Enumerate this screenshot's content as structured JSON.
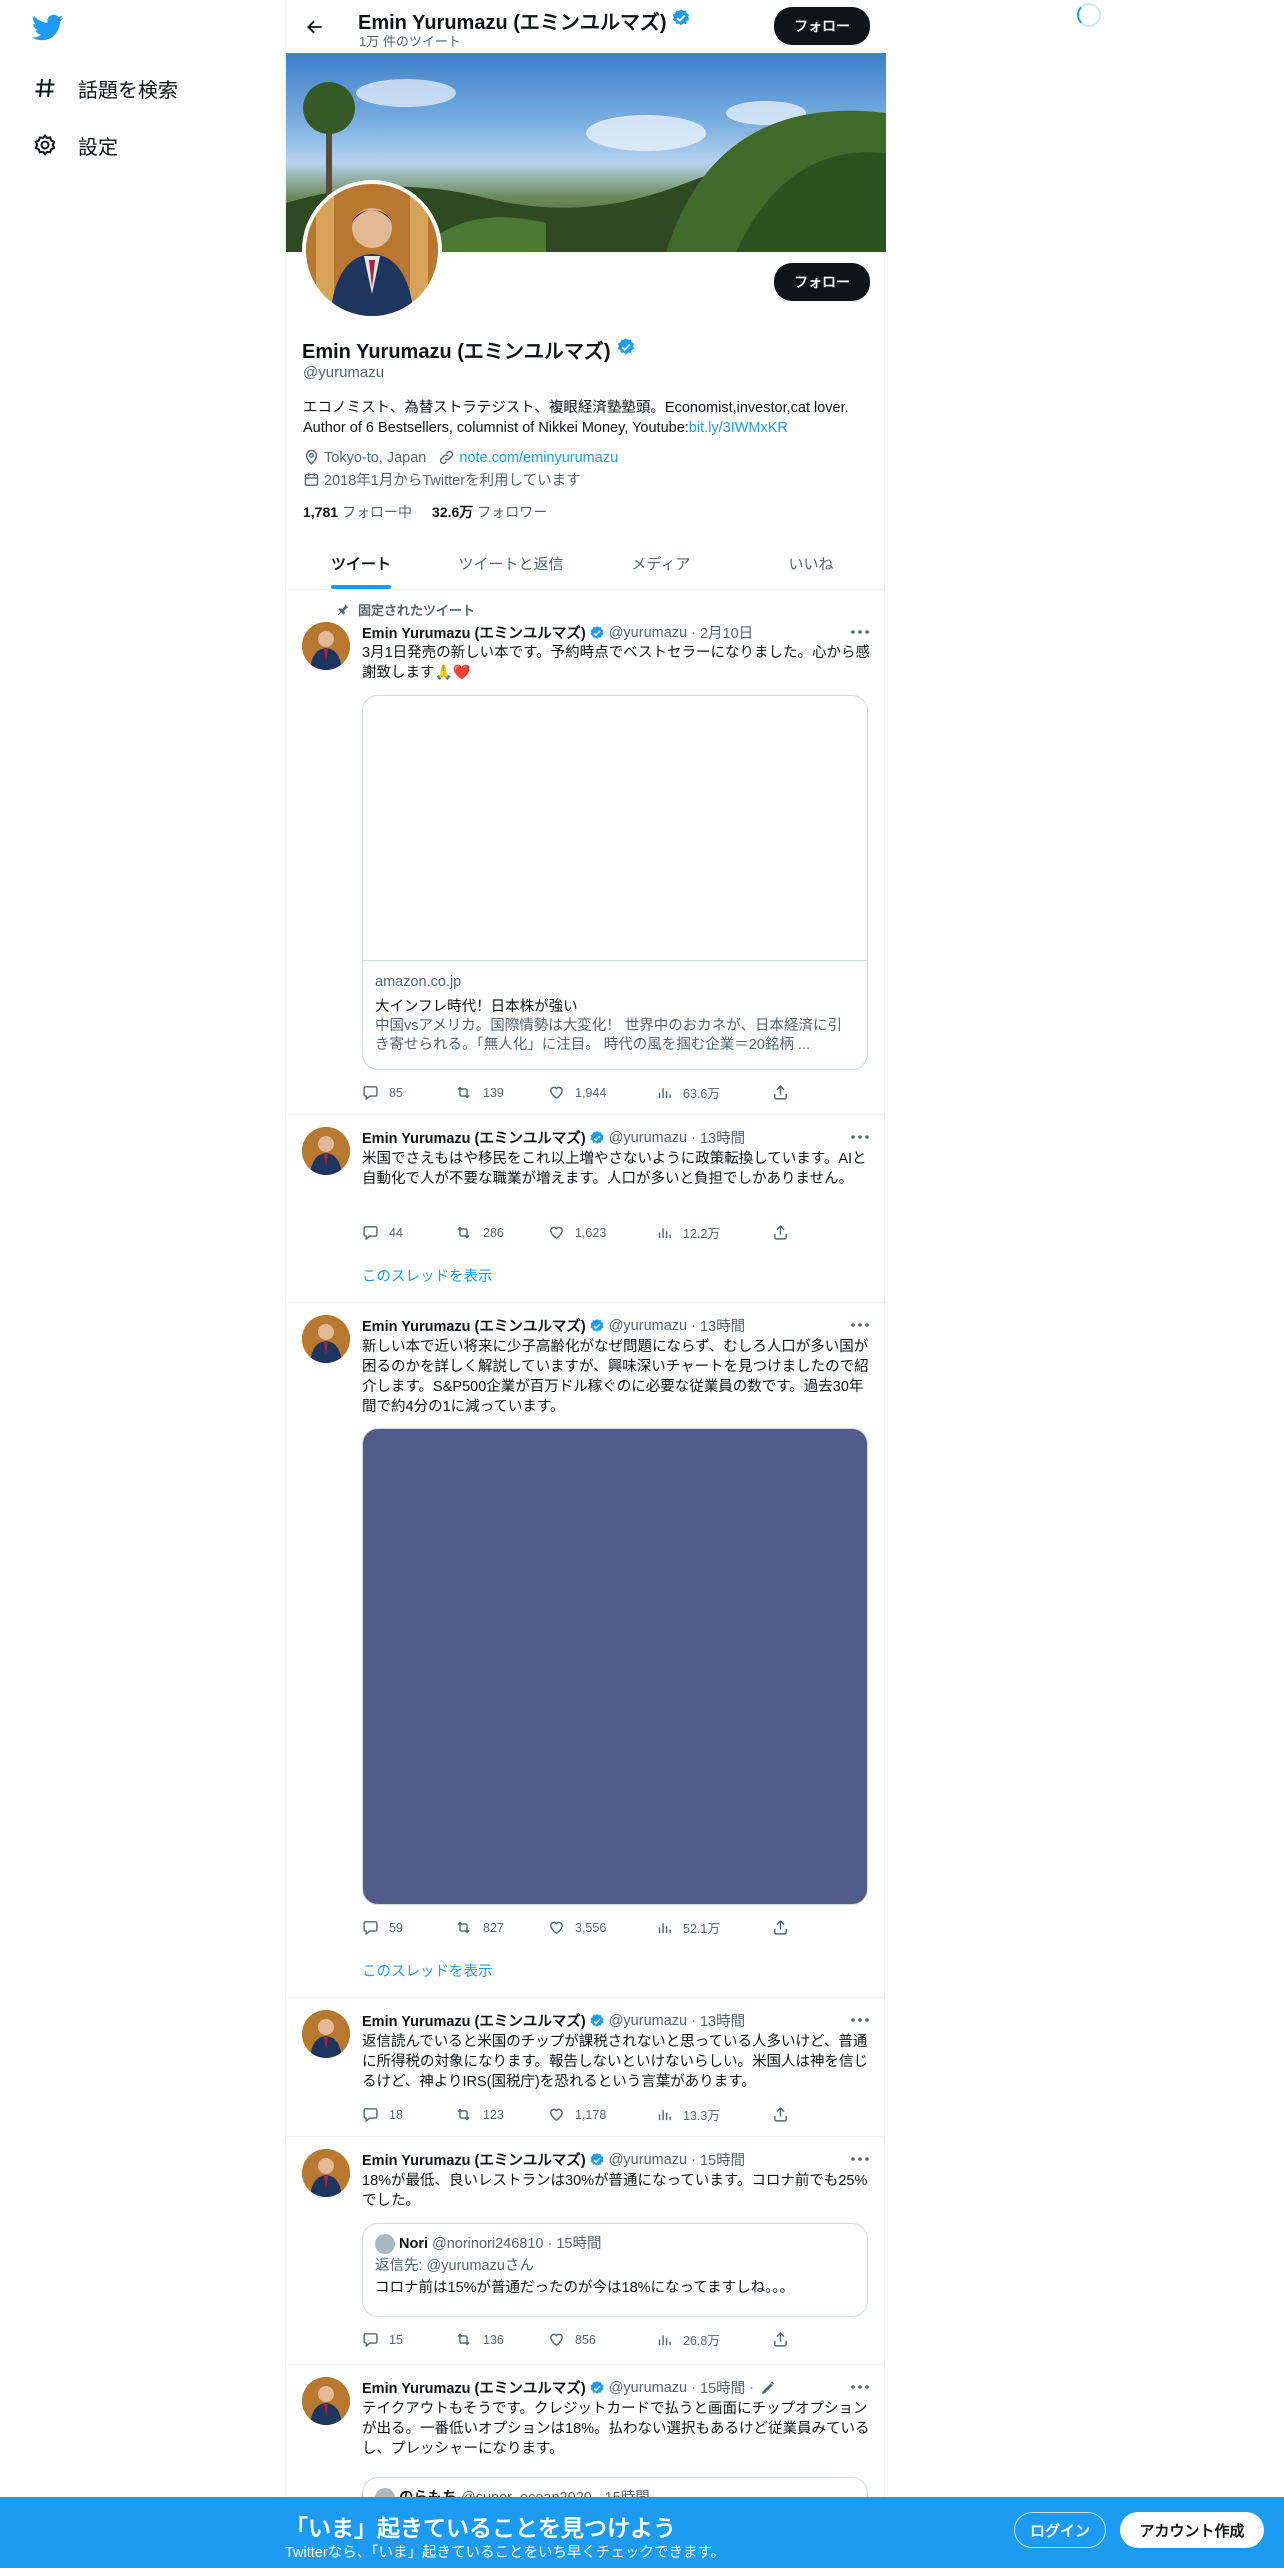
{
  "nav": {
    "explore_label": "話題を検索",
    "settings_label": "設定"
  },
  "header": {
    "name": "Emin Yurumazu (エミンユルマズ)",
    "tweet_count": "1万 件のツイート",
    "follow_label": "フォロー"
  },
  "profile": {
    "name": "Emin Yurumazu (エミンユルマズ)",
    "handle": "@yurumazu",
    "bio_text": "エコノミスト、為替ストラテジスト、複眼経済塾塾頭。Economist,investor,cat lover. Author of 6 Bestsellers, columnist of Nikkei Money, Youtube:",
    "bio_link": "bit.ly/3IWMxKR",
    "location": "Tokyo-to, Japan",
    "website": "note.com/eminyurumazu",
    "joined": "2018年1月からTwitterを利用しています",
    "following_count": "1,781",
    "following_label": "フォロー中",
    "followers_count": "32.6万",
    "followers_label": "フォロワー",
    "follow_label": "フォロー"
  },
  "tabs": [
    "ツイート",
    "ツイートと返信",
    "メディア",
    "いいね"
  ],
  "tweets": [
    {
      "pinned_label": "固定されたツイート",
      "name": "Emin Yurumazu (エミンユルマズ)",
      "handle": "@yurumazu",
      "time": "2月10日",
      "text": "3月1日発売の新しい本です。予約時点でベストセラーになりました。心から感謝致します🙏❤️",
      "card": {
        "domain": "amazon.co.jp",
        "title": "大インフレ時代！日本株が強い",
        "description": "中国vsアメリカ。国際情勢は大変化！ 世界中のおカネが、日本経済に引き寄せられる。「無人化」に注目。 時代の風を掴む企業＝20銘柄 ..."
      },
      "replies": "85",
      "retweets": "139",
      "likes": "1,944",
      "views": "63.6万"
    },
    {
      "name": "Emin Yurumazu (エミンユルマズ)",
      "handle": "@yurumazu",
      "time": "13時間",
      "text": "米国でさえもはや移民をこれ以上増やさないように政策転換しています。AIと自動化で人が不要な職業が増えます。人口が多いと負担でしかありません。",
      "replies": "44",
      "retweets": "286",
      "likes": "1,623",
      "views": "12.2万",
      "thread_label": "このスレッドを表示"
    },
    {
      "name": "Emin Yurumazu (エミンユルマズ)",
      "handle": "@yurumazu",
      "time": "13時間",
      "text": "新しい本で近い将来に少子高齢化がなぜ問題にならず、むしろ人口が多い国が困るのかを詳しく解説していますが、興味深いチャートを見つけましたので紹介します。S&P500企業が百万ドル稼ぐのに必要な従業員の数です。過去30年間で約4分の1に減っています。",
      "replies": "59",
      "retweets": "827",
      "likes": "3,556",
      "views": "52.1万",
      "thread_label": "このスレッドを表示"
    },
    {
      "name": "Emin Yurumazu (エミンユルマズ)",
      "handle": "@yurumazu",
      "time": "13時間",
      "text": "返信読んでいると米国のチップが課税されないと思っている人多いけど、普通に所得税の対象になります。報告しないといけないらしい。米国人は神を信じるけど、神よりIRS(国税庁)を恐れるという言葉があります。",
      "replies": "18",
      "retweets": "123",
      "likes": "1,178",
      "views": "13.3万"
    },
    {
      "name": "Emin Yurumazu (エミンユルマズ)",
      "handle": "@yurumazu",
      "time": "15時間",
      "text": "18%が最低、良いレストランは30%が普通になっています。コロナ前でも25%でした。",
      "quote": {
        "name": "Nori",
        "handle": "@norinori246810",
        "time": "15時間",
        "reply_to": "返信先: @yurumazuさん",
        "text": "コロナ前は15%が普通だったのが今は18%になってますしね。。。"
      },
      "replies": "15",
      "retweets": "136",
      "likes": "856",
      "views": "26.8万"
    },
    {
      "name": "Emin Yurumazu (エミンユルマズ)",
      "handle": "@yurumazu",
      "time": "15時間",
      "text": "テイクアウトもそうです。クレジットカードで払うと画面にチップオプションが出る。一番低いオプションは18%。払わない選択もあるけど従業員みているし、プレッシャーになります。",
      "quote_partial": {
        "name": "のらもち",
        "handle": "@super_ocean2020",
        "time": "15時間"
      }
    }
  ],
  "bottom_bar": {
    "title": "「いま」起きていることを見つけよう",
    "subtitle": "Twitterなら、「いま」起きていることをいち早くチェックできます。",
    "login_label": "ログイン",
    "signup_label": "アカウント作成"
  },
  "colors": {
    "accent": "#1d9bf0",
    "text": "#0f1419",
    "muted": "#536471",
    "media_placeholder": "#525c8a"
  }
}
